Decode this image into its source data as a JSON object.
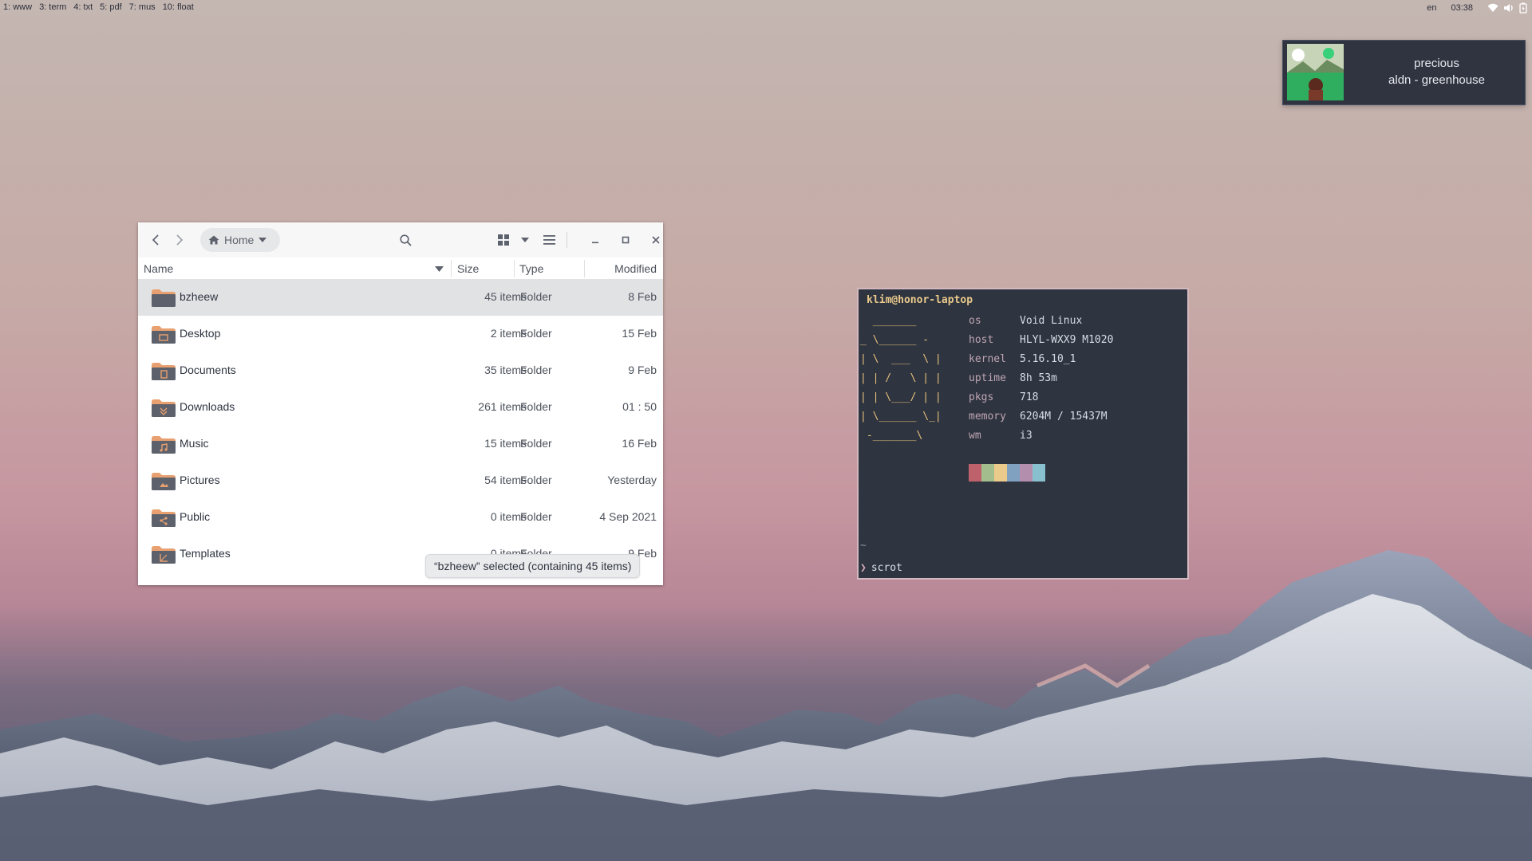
{
  "bar": {
    "workspaces": [
      "1: www",
      "3: term",
      "4: txt",
      "5: pdf",
      "7: mus",
      "10: float"
    ],
    "lang": "en",
    "clock": "03:38"
  },
  "notification": {
    "title": "precious",
    "body": "aldn - greenhouse"
  },
  "file_manager": {
    "path_label": "Home",
    "columns": {
      "name": "Name",
      "size": "Size",
      "type": "Type",
      "modified": "Modified"
    },
    "rows": [
      {
        "name": "bzheew",
        "size": "45 items",
        "type": "Folder",
        "modified": "8 Feb",
        "icon": "folder-icon"
      },
      {
        "name": "Desktop",
        "size": "2 items",
        "type": "Folder",
        "modified": "15 Feb",
        "icon": "folder-desktop-icon"
      },
      {
        "name": "Documents",
        "size": "35 items",
        "type": "Folder",
        "modified": "9 Feb",
        "icon": "folder-documents-icon"
      },
      {
        "name": "Downloads",
        "size": "261 items",
        "type": "Folder",
        "modified": "01 : 50",
        "icon": "folder-downloads-icon"
      },
      {
        "name": "Music",
        "size": "15 items",
        "type": "Folder",
        "modified": "16 Feb",
        "icon": "folder-music-icon"
      },
      {
        "name": "Pictures",
        "size": "54 items",
        "type": "Folder",
        "modified": "Yesterday",
        "icon": "folder-pictures-icon"
      },
      {
        "name": "Public",
        "size": "0 items",
        "type": "Folder",
        "modified": "4 Sep 2021",
        "icon": "folder-public-icon"
      },
      {
        "name": "Templates",
        "size": "0 items",
        "type": "Folder",
        "modified": "9 Feb",
        "icon": "folder-templates-icon"
      }
    ],
    "status": "“bzheew” selected  (containing 45 items)"
  },
  "terminal": {
    "title": "klim@honor-laptop",
    "logo": "  _______\n_ \\______ -\n| \\  ___  \\ |\n| | /   \\ | |\n| | \\___/ | |\n| \\______ \\_|\n -_______\\",
    "info": [
      {
        "key": "os",
        "value": "Void Linux"
      },
      {
        "key": "host",
        "value": "HLYL-WXX9 M1020"
      },
      {
        "key": "kernel",
        "value": "5.16.10_1"
      },
      {
        "key": "uptime",
        "value": "8h 53m"
      },
      {
        "key": "pkgs",
        "value": "718"
      },
      {
        "key": "memory",
        "value": "6204M / 15437M"
      },
      {
        "key": "wm",
        "value": "i3"
      }
    ],
    "palette": [
      "#bf616a",
      "#a3be8c",
      "#ebcb8b",
      "#81a1c1",
      "#b48ead",
      "#88c0d0"
    ],
    "cwd": "~",
    "command": "scrot"
  },
  "colors": {
    "terminal_bg": "#2e3440",
    "logo_yellow": "#e5c07b",
    "selection": "#e1e2e4",
    "folder_dark": "#5c616c",
    "folder_accent": "#e8a070"
  }
}
